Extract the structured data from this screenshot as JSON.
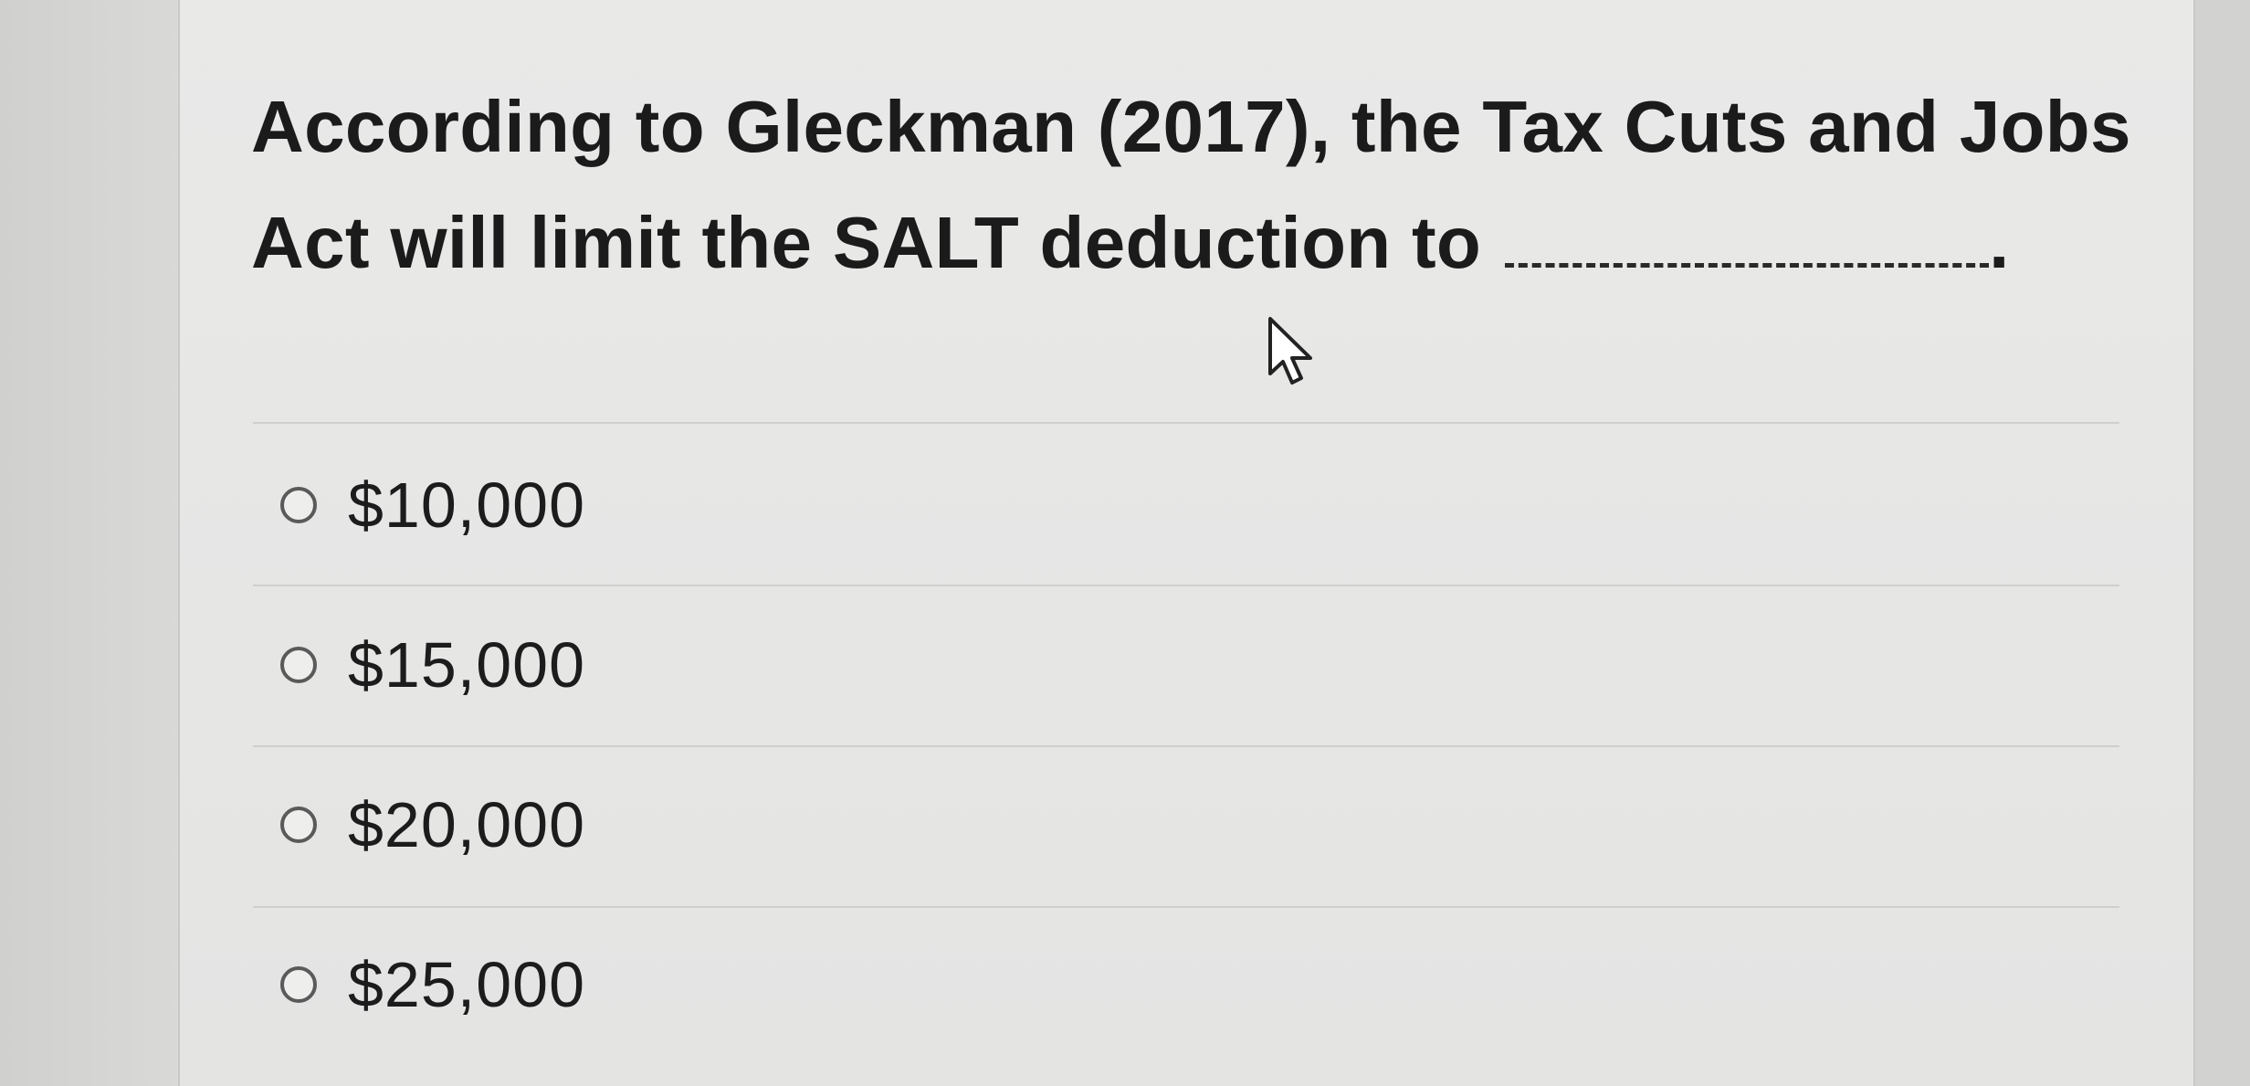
{
  "question": {
    "text": "According to Gleckman (2017), the Tax Cuts and Jobs Act will limit the SALT deduction to",
    "blank_end": "."
  },
  "options": [
    {
      "label": "$10,000",
      "selected": false
    },
    {
      "label": "$15,000",
      "selected": false
    },
    {
      "label": "$20,000",
      "selected": false
    },
    {
      "label": "$25,000",
      "selected": false
    }
  ],
  "icons": {
    "radio": "radio-unchecked-icon",
    "cursor": "mouse-pointer-icon"
  }
}
